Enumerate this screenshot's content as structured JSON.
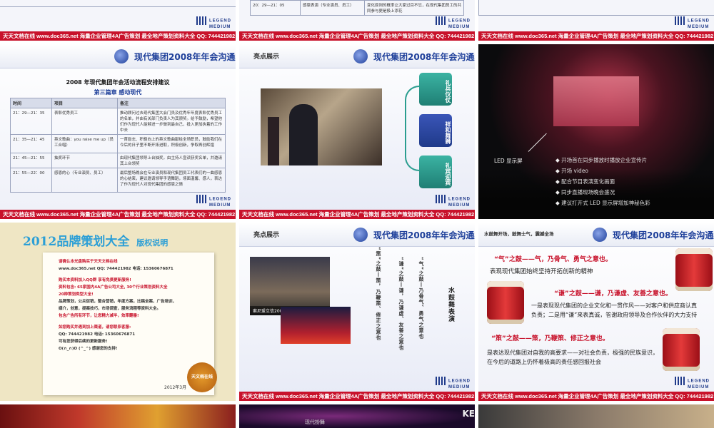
{
  "footer_text": "天天文档在线  www.doc365.net  海量企业管理4A广告策划  最全地产策划资料大全  QQ: 744421982",
  "logo": {
    "line1": "LEGEND",
    "line2": "MEDIUM"
  },
  "deck_title": "现代集团2008年年会沟通案",
  "top_row": {
    "middle_row_text": "20：29—21：05",
    "middle_row_item": "感恩表演（专业演员、员工）",
    "middle_row_note": "变化原则的概率让大家过目不忘，在现代集团员工的共同参与更是极上添花"
  },
  "slide_table": {
    "heading": "2008 年现代集团年会活动流程安排建议",
    "chapter": "第三篇章  感动现代",
    "columns": [
      "时间",
      "项目",
      "备注"
    ],
    "rows": [
      {
        "time": "21：29—21：35",
        "item": "表彰优秀员工",
        "note": "推动顾问过去现代集团大会门员及优秀年年度表彰优秀员工的名单，并由有关部门负责人为其颁奖。给予鼓励，希望他们作为现代人能够进一步做到最自己，投入更加执着的工作中去"
      },
      {
        "time": "21：35—21：45",
        "item": "英文歌曲：you raise me up（员工合唱）",
        "note": "一首励志、积极向上的英文歌曲献给全场职员，鼓励我们在今后的日子里不断开拓进取，积极创新，争取再创辉煌"
      },
      {
        "time": "21：45—21：55",
        "item": "抽奖环节",
        "note": "由现代集团领导上台抽奖，由主持人宣读获奖名单，并邀请其上台领奖"
      },
      {
        "time": "21：55—22：00",
        "item": "感恩的心（专业演员、员工）",
        "note": "最后整场晚会在专业演员和现代集团员工代表们的一曲感恩的心结束，建议邀请领导手语舞蹈，场面温馨、感人，表达了作为现代人对现代集团的感恩之情"
      }
    ]
  },
  "slide_highlight1": {
    "kicker": "亮点展示",
    "boxes": [
      "礼兵仪仗",
      "祥和舞狮",
      "礼宾迎宾"
    ]
  },
  "slide_stage": {
    "led_label": "LED 显示屏",
    "bullets": [
      "开场首在同步播放时播放企业宣传片",
      "开场 video",
      "配合节目表演变化画面",
      "同步直播现场晚会盛况",
      "建议打开式 LED 显示屏增加神秘色彩"
    ]
  },
  "slide_promo": {
    "title": "2012品牌策划大全",
    "title_suffix": "版权说明",
    "lines": [
      "请确认本光盘购买于天天文档在线",
      "www.doc365.net   QQ: 744421982   电话: 15360676871",
      "购买本资料加入QQ群  享有免费更新服务!",
      "资料包含: 65家国内4A广告公司大全, 30个行业策划资料大全",
      "20种策划类型大全!",
      "品牌策划，公关促销，整合营销，年度方案，比稿全案，广告培训，",
      "媒介，创意，提案技巧，市场调查，服务流程等资料大全。",
      "包含广告所有环节，让您精力减半，效率翻番!",
      "如您购买并遇到加上渠道，请您联系客服:",
      "QQ: 744421982   电话: 15360676871",
      "可有您获得后续的更新服务!",
      "O(∩_∩)O   (^_^)   感谢您的支持!"
    ],
    "date": "2012年3月",
    "badge": "天文档在线"
  },
  "slide_highlight2": {
    "kicker": "亮点展示",
    "photo_caption": "索尼爱立信2007中国峰会",
    "columns": [
      "“气”之鼓—乃骨气、勇气之意也",
      "“谦”之鼓—谦，乃谦虚、友善之意也",
      "“策”之鼓—策，乃鞭策、修正之意也"
    ],
    "side_title": "水鼓舞表演"
  },
  "slide_drums": {
    "kicker": "水鼓舞开场，鼓舞士气，震撼全场",
    "h1": "“气”之鼓——气，乃骨气、勇气之意也。",
    "p1": "表现现代集团始终坚持开拓创新的精神",
    "h2": "“谦”之鼓——谦，乃谦虚、友善之意也。",
    "p2": "一是表现现代集团的企业文化和一贯作风——对客户和供应商认真负责；二是用“谦”来表真诚，答谢政府领导及合作伙伴的大力支持",
    "h3": "“策”之鼓——策，乃鞭策、修正之意也。",
    "p3": "是表达现代集团对自我的高要求——对社会负责，极强的民族意识，在今后的道路上仍怀着极高的责任感回报社会"
  },
  "bottom_row": {
    "caption": "现代扮舞",
    "edge_text": "KE"
  },
  "colors": {
    "footer_red": "#c8122b",
    "title_blue": "#1e3f9a",
    "box_teal": "#2a9d8f",
    "box_navy": "#1f3a8a"
  }
}
